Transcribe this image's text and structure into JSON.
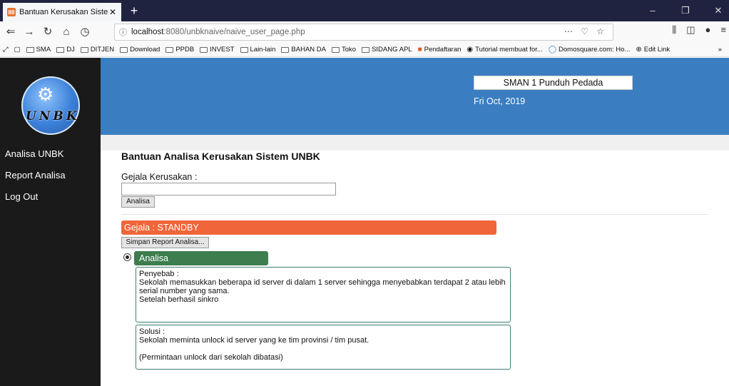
{
  "browser": {
    "tab_title": "Bantuan Kerusakan Sistem UNE",
    "tab_close": "✕",
    "new_tab": "+",
    "url_info_icon": "ⓘ",
    "url_host": "localhost",
    "url_rest": ":8080/unbknaive/naive_user_page.php",
    "url_actions": "⋯ ♡ ☆",
    "bookmarks": [
      "SMA",
      "DJ",
      "DITJEN",
      "Download",
      "PPDB",
      "INVEST",
      "Lain-lain",
      "BAHAN DA",
      "Toko",
      "SIDANG APL"
    ],
    "bookmark_pendaftaran": "Pendaftaran",
    "bookmark_tutorial": "Tutorial membuat for...",
    "bookmark_domosquare": "Domosquare.com: Ho...",
    "bookmark_editlink": "Edit Link",
    "bookmark_more": "»"
  },
  "sidebar": {
    "logo_text": "UNBK",
    "menu": [
      "Analisa UNBK",
      "Report Analisa",
      "Log Out"
    ]
  },
  "header": {
    "school": "SMAN 1 Punduh Pedada",
    "date": "Fri Oct, 2019"
  },
  "main": {
    "title": "Bantuan Analisa Kerusakan Sistem UNBK",
    "gejala_label": "Gejala Kerusakan :",
    "analisa_button": "Analisa",
    "symptom": "Gejala : STANDBY",
    "save_button": "Simpan Report Analisa...",
    "analisa_section": "Analisa",
    "penyebab_label": "Penyebab :",
    "penyebab_line1": "Sekolah memasukkan beberapa id server di dalam 1 server sehingga menyebabkan terdapat 2 atau lebih",
    "penyebab_line2": "serial number yang sama.",
    "penyebab_line3": "Setelah berhasil sinkro",
    "solusi_label": "Solusi :",
    "solusi_line1": "Sekolah meminta unlock id server yang ke tim provinsi / tim pusat.",
    "solusi_line2": "(Permintaan unlock dari sekolah dibatasi)"
  }
}
